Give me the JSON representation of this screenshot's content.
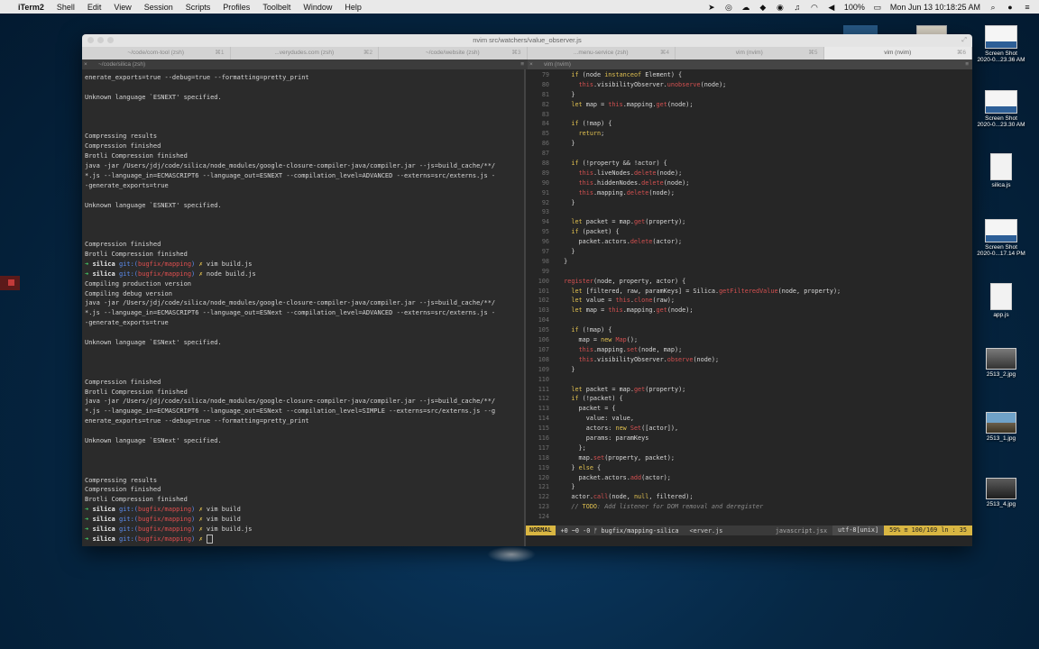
{
  "menubar": {
    "apple": "",
    "app": "iTerm2",
    "items": [
      "Shell",
      "Edit",
      "View",
      "Session",
      "Scripts",
      "Profiles",
      "Toolbelt",
      "Window",
      "Help"
    ],
    "battery": "100%",
    "datetime": "Mon Jun 13  10:18:25 AM"
  },
  "window": {
    "title": "nvim src/watchers/value_observer.js",
    "tabs": [
      {
        "label": "~/code/com-tool (zsh)",
        "num": "⌘1",
        "active": false
      },
      {
        "label": "...verydudes.com (zsh)",
        "num": "⌘2",
        "active": false
      },
      {
        "label": "~/code/website (zsh)",
        "num": "⌘3",
        "active": false
      },
      {
        "label": "...menu-service (zsh)",
        "num": "⌘4",
        "active": false
      },
      {
        "label": "vim (nvim)",
        "num": "⌘5",
        "active": false
      },
      {
        "label": "vim (nvim)",
        "num": "⌘6",
        "active": true
      }
    ],
    "pane_left_title": "~/code/silica (zsh)",
    "pane_right_title": "vim (nvim)"
  },
  "terminal": {
    "lines": [
      {
        "t": "enerate_exports=true --debug=true --formatting=pretty_print"
      },
      {
        "t": ""
      },
      {
        "t": "Unknown language `ESNEXT' specified."
      },
      {
        "t": ""
      },
      {
        "t": ""
      },
      {
        "t": ""
      },
      {
        "t": "Compressing results"
      },
      {
        "t": "Compression finished"
      },
      {
        "t": "Brotli Compression finished"
      },
      {
        "t": "java -jar /Users/jdj/code/silica/node_modules/google-closure-compiler-java/compiler.jar --js=build_cache/**/"
      },
      {
        "t": "*.js --language_in=ECMASCRIPT6 --language_out=ESNEXT --compilation_level=ADVANCED --externs=src/externs.js -"
      },
      {
        "t": "-generate_exports=true"
      },
      {
        "t": ""
      },
      {
        "t": "Unknown language `ESNEXT' specified."
      },
      {
        "t": ""
      },
      {
        "t": ""
      },
      {
        "t": ""
      },
      {
        "t": "Compression finished"
      },
      {
        "t": "Brotli Compression finished"
      },
      {
        "p": true,
        "cmd": "vim build.js"
      },
      {
        "p": true,
        "cmd": "node build.js"
      },
      {
        "t": "Compiling production version"
      },
      {
        "t": "Compiling debug version"
      },
      {
        "t": "java -jar /Users/jdj/code/silica/node_modules/google-closure-compiler-java/compiler.jar --js=build_cache/**/"
      },
      {
        "t": "*.js --language_in=ECMASCRIPT6 --language_out=ESNext --compilation_level=ADVANCED --externs=src/externs.js -"
      },
      {
        "t": "-generate_exports=true"
      },
      {
        "t": ""
      },
      {
        "t": "Unknown language `ESNext' specified."
      },
      {
        "t": ""
      },
      {
        "t": ""
      },
      {
        "t": ""
      },
      {
        "t": "Compression finished"
      },
      {
        "t": "Brotli Compression finished"
      },
      {
        "t": "java -jar /Users/jdj/code/silica/node_modules/google-closure-compiler-java/compiler.jar --js=build_cache/**/"
      },
      {
        "t": "*.js --language_in=ECMASCRIPT6 --language_out=ESNext --compilation_level=SIMPLE --externs=src/externs.js --g"
      },
      {
        "t": "enerate_exports=true --debug=true --formatting=pretty_print"
      },
      {
        "t": ""
      },
      {
        "t": "Unknown language `ESNext' specified."
      },
      {
        "t": ""
      },
      {
        "t": ""
      },
      {
        "t": ""
      },
      {
        "t": "Compressing results"
      },
      {
        "t": "Compression finished"
      },
      {
        "t": "Brotli Compression finished"
      },
      {
        "p": true,
        "cmd": "vim build"
      },
      {
        "p": true,
        "cmd": "vim build"
      },
      {
        "p": true,
        "cmd": "vim build.js"
      },
      {
        "p": true,
        "cmd": "",
        "cursor": true
      }
    ],
    "prompt": {
      "arrow": "➜",
      "dir": "silica",
      "git": "git:(",
      "branch": "bugfix/mapping",
      "close": ")",
      "mark": "✗"
    }
  },
  "code": {
    "lines": [
      {
        "n": "79",
        "s": [
          [
            "",
            "    "
          ],
          [
            "kw",
            "if"
          ],
          [
            "",
            " (node "
          ],
          [
            "kw",
            "instanceof"
          ],
          [
            "",
            " Element) {"
          ]
        ]
      },
      {
        "n": "80",
        "s": [
          [
            "",
            "      "
          ],
          [
            "th",
            "this"
          ],
          [
            "",
            ".visibilityObserver."
          ],
          [
            "fn",
            "unobserve"
          ],
          [
            "",
            "(node);"
          ]
        ]
      },
      {
        "n": "81",
        "s": [
          [
            "",
            "    }"
          ]
        ]
      },
      {
        "n": "82",
        "s": [
          [
            "",
            "    "
          ],
          [
            "kw",
            "let"
          ],
          [
            "",
            " map = "
          ],
          [
            "th",
            "this"
          ],
          [
            "",
            ".mapping."
          ],
          [
            "fn",
            "get"
          ],
          [
            "",
            "(node);"
          ]
        ]
      },
      {
        "n": "83",
        "s": [
          [
            "",
            ""
          ]
        ]
      },
      {
        "n": "84",
        "s": [
          [
            "",
            "    "
          ],
          [
            "kw",
            "if"
          ],
          [
            "",
            " (!map) {"
          ]
        ]
      },
      {
        "n": "85",
        "s": [
          [
            "",
            "      "
          ],
          [
            "kw",
            "return"
          ],
          [
            "",
            ";"
          ]
        ]
      },
      {
        "n": "86",
        "s": [
          [
            "",
            "    }"
          ]
        ]
      },
      {
        "n": "87",
        "s": [
          [
            "",
            ""
          ]
        ]
      },
      {
        "n": "88",
        "s": [
          [
            "",
            "    "
          ],
          [
            "kw",
            "if"
          ],
          [
            "",
            " (!property && !actor) {"
          ]
        ]
      },
      {
        "n": "89",
        "s": [
          [
            "",
            "      "
          ],
          [
            "th",
            "this"
          ],
          [
            "",
            ".liveNodes."
          ],
          [
            "fn",
            "delete"
          ],
          [
            "",
            "(node);"
          ]
        ]
      },
      {
        "n": "90",
        "s": [
          [
            "",
            "      "
          ],
          [
            "th",
            "this"
          ],
          [
            "",
            ".hiddenNodes."
          ],
          [
            "fn",
            "delete"
          ],
          [
            "",
            "(node);"
          ]
        ]
      },
      {
        "n": "91",
        "s": [
          [
            "",
            "      "
          ],
          [
            "th",
            "this"
          ],
          [
            "",
            ".mapping."
          ],
          [
            "fn",
            "delete"
          ],
          [
            "",
            "(node);"
          ]
        ]
      },
      {
        "n": "92",
        "s": [
          [
            "",
            "    }"
          ]
        ]
      },
      {
        "n": "93",
        "s": [
          [
            "",
            ""
          ]
        ]
      },
      {
        "n": "94",
        "s": [
          [
            "",
            "    "
          ],
          [
            "kw",
            "let"
          ],
          [
            "",
            " packet = map."
          ],
          [
            "fn",
            "get"
          ],
          [
            "",
            "(property);"
          ]
        ]
      },
      {
        "n": "95",
        "s": [
          [
            "",
            "    "
          ],
          [
            "kw",
            "if"
          ],
          [
            "",
            " (packet) {"
          ]
        ]
      },
      {
        "n": "96",
        "s": [
          [
            "",
            "      packet.actors."
          ],
          [
            "fn",
            "delete"
          ],
          [
            "",
            "(actor);"
          ]
        ]
      },
      {
        "n": "97",
        "s": [
          [
            "",
            "    }"
          ]
        ]
      },
      {
        "n": "98",
        "s": [
          [
            "",
            "  }"
          ]
        ]
      },
      {
        "n": "99",
        "s": [
          [
            "",
            ""
          ]
        ]
      },
      {
        "n": "100",
        "s": [
          [
            "",
            "  "
          ],
          [
            "fn",
            "register"
          ],
          [
            "",
            "(node, property, actor) {"
          ]
        ]
      },
      {
        "n": "101",
        "s": [
          [
            "",
            "    "
          ],
          [
            "kw",
            "let"
          ],
          [
            "",
            " [filtered, raw, paramKeys] = Silica."
          ],
          [
            "fn",
            "getFilteredValue"
          ],
          [
            "",
            "(node, property);"
          ]
        ]
      },
      {
        "n": "102",
        "s": [
          [
            "",
            "    "
          ],
          [
            "kw",
            "let"
          ],
          [
            "",
            " value = "
          ],
          [
            "th",
            "this"
          ],
          [
            "",
            "."
          ],
          [
            "fn",
            "clone"
          ],
          [
            "",
            "(raw);"
          ]
        ]
      },
      {
        "n": "103",
        "s": [
          [
            "",
            "    "
          ],
          [
            "kw",
            "let"
          ],
          [
            "",
            " map = "
          ],
          [
            "th",
            "this"
          ],
          [
            "",
            ".mapping."
          ],
          [
            "fn",
            "get"
          ],
          [
            "",
            "(node);"
          ]
        ]
      },
      {
        "n": "104",
        "s": [
          [
            "",
            ""
          ]
        ]
      },
      {
        "n": "105",
        "s": [
          [
            "",
            "    "
          ],
          [
            "kw",
            "if"
          ],
          [
            "",
            " (!map) {"
          ]
        ]
      },
      {
        "n": "106",
        "s": [
          [
            "",
            "      map = "
          ],
          [
            "kw",
            "new"
          ],
          [
            "",
            " "
          ],
          [
            "fn",
            "Map"
          ],
          [
            "",
            "();"
          ]
        ]
      },
      {
        "n": "107",
        "s": [
          [
            "",
            "      "
          ],
          [
            "th",
            "this"
          ],
          [
            "",
            ".mapping."
          ],
          [
            "fn",
            "set"
          ],
          [
            "",
            "(node, map);"
          ]
        ]
      },
      {
        "n": "108",
        "s": [
          [
            "",
            "      "
          ],
          [
            "th",
            "this"
          ],
          [
            "",
            ".visibilityObserver."
          ],
          [
            "fn",
            "observe"
          ],
          [
            "",
            "(node);"
          ]
        ]
      },
      {
        "n": "109",
        "s": [
          [
            "",
            "    }"
          ]
        ]
      },
      {
        "n": "110",
        "s": [
          [
            "",
            ""
          ]
        ]
      },
      {
        "n": "111",
        "s": [
          [
            "",
            "    "
          ],
          [
            "kw",
            "let"
          ],
          [
            "",
            " packet = map."
          ],
          [
            "fn",
            "get"
          ],
          [
            "",
            "(property);"
          ]
        ]
      },
      {
        "n": "112",
        "s": [
          [
            "",
            "    "
          ],
          [
            "kw",
            "if"
          ],
          [
            "",
            " (!packet) {"
          ]
        ]
      },
      {
        "n": "113",
        "s": [
          [
            "",
            "      packet = {"
          ]
        ]
      },
      {
        "n": "114",
        "s": [
          [
            "",
            "        value: value,"
          ]
        ]
      },
      {
        "n": "115",
        "s": [
          [
            "",
            "        actors: "
          ],
          [
            "kw",
            "new"
          ],
          [
            "",
            " "
          ],
          [
            "fn",
            "Set"
          ],
          [
            "",
            "([actor]),"
          ]
        ]
      },
      {
        "n": "116",
        "s": [
          [
            "",
            "        params: paramKeys"
          ]
        ]
      },
      {
        "n": "117",
        "s": [
          [
            "",
            "      };"
          ]
        ]
      },
      {
        "n": "118",
        "s": [
          [
            "",
            "      map."
          ],
          [
            "fn",
            "set"
          ],
          [
            "",
            "(property, packet);"
          ]
        ]
      },
      {
        "n": "119",
        "s": [
          [
            "",
            "    } "
          ],
          [
            "kw",
            "else"
          ],
          [
            "",
            " {"
          ]
        ]
      },
      {
        "n": "120",
        "s": [
          [
            "",
            "      packet.actors."
          ],
          [
            "fn",
            "add"
          ],
          [
            "",
            "(actor);"
          ]
        ]
      },
      {
        "n": "121",
        "s": [
          [
            "",
            "    }"
          ]
        ]
      },
      {
        "n": "122",
        "s": [
          [
            "",
            "    actor."
          ],
          [
            "fn",
            "call"
          ],
          [
            "",
            "(node, "
          ],
          [
            "kw",
            "null"
          ],
          [
            "",
            ", filtered);"
          ]
        ]
      },
      {
        "n": "123",
        "s": [
          [
            "",
            "    "
          ],
          [
            "cm",
            "// "
          ],
          [
            "todo",
            "TODO"
          ],
          [
            "cm",
            ": Add listener for DOM removal and deregister"
          ]
        ]
      },
      {
        "n": "124",
        "s": [
          [
            "",
            ""
          ]
        ]
      }
    ]
  },
  "statusline": {
    "mode": "NORMAL",
    "git": "+0 ~0 -0 ᚠ bugfix/mapping-silica",
    "file": "<erver.js",
    "filetype": "javascript.jsx",
    "encoding": "utf-8[unix]",
    "position": "59% ≡ 100/169 ln : 35"
  },
  "desktop": {
    "icons": [
      {
        "label": "Screen Shot\n2020-0...23.36 AM",
        "kind": "shot"
      },
      {
        "label": "Screen Shot\n2020-0...23.30 AM",
        "kind": "shot"
      },
      {
        "label": "silica.js",
        "kind": "doc"
      },
      {
        "label": "Screen Shot\n2020-0...17.14 PM",
        "kind": "shot"
      },
      {
        "label": "app.js",
        "kind": "doc"
      },
      {
        "label": "2513_2.jpg",
        "kind": "photo"
      },
      {
        "label": "2513_1.jpg",
        "kind": "photo2"
      },
      {
        "label": "2513_4.jpg",
        "kind": "photo3"
      }
    ]
  }
}
